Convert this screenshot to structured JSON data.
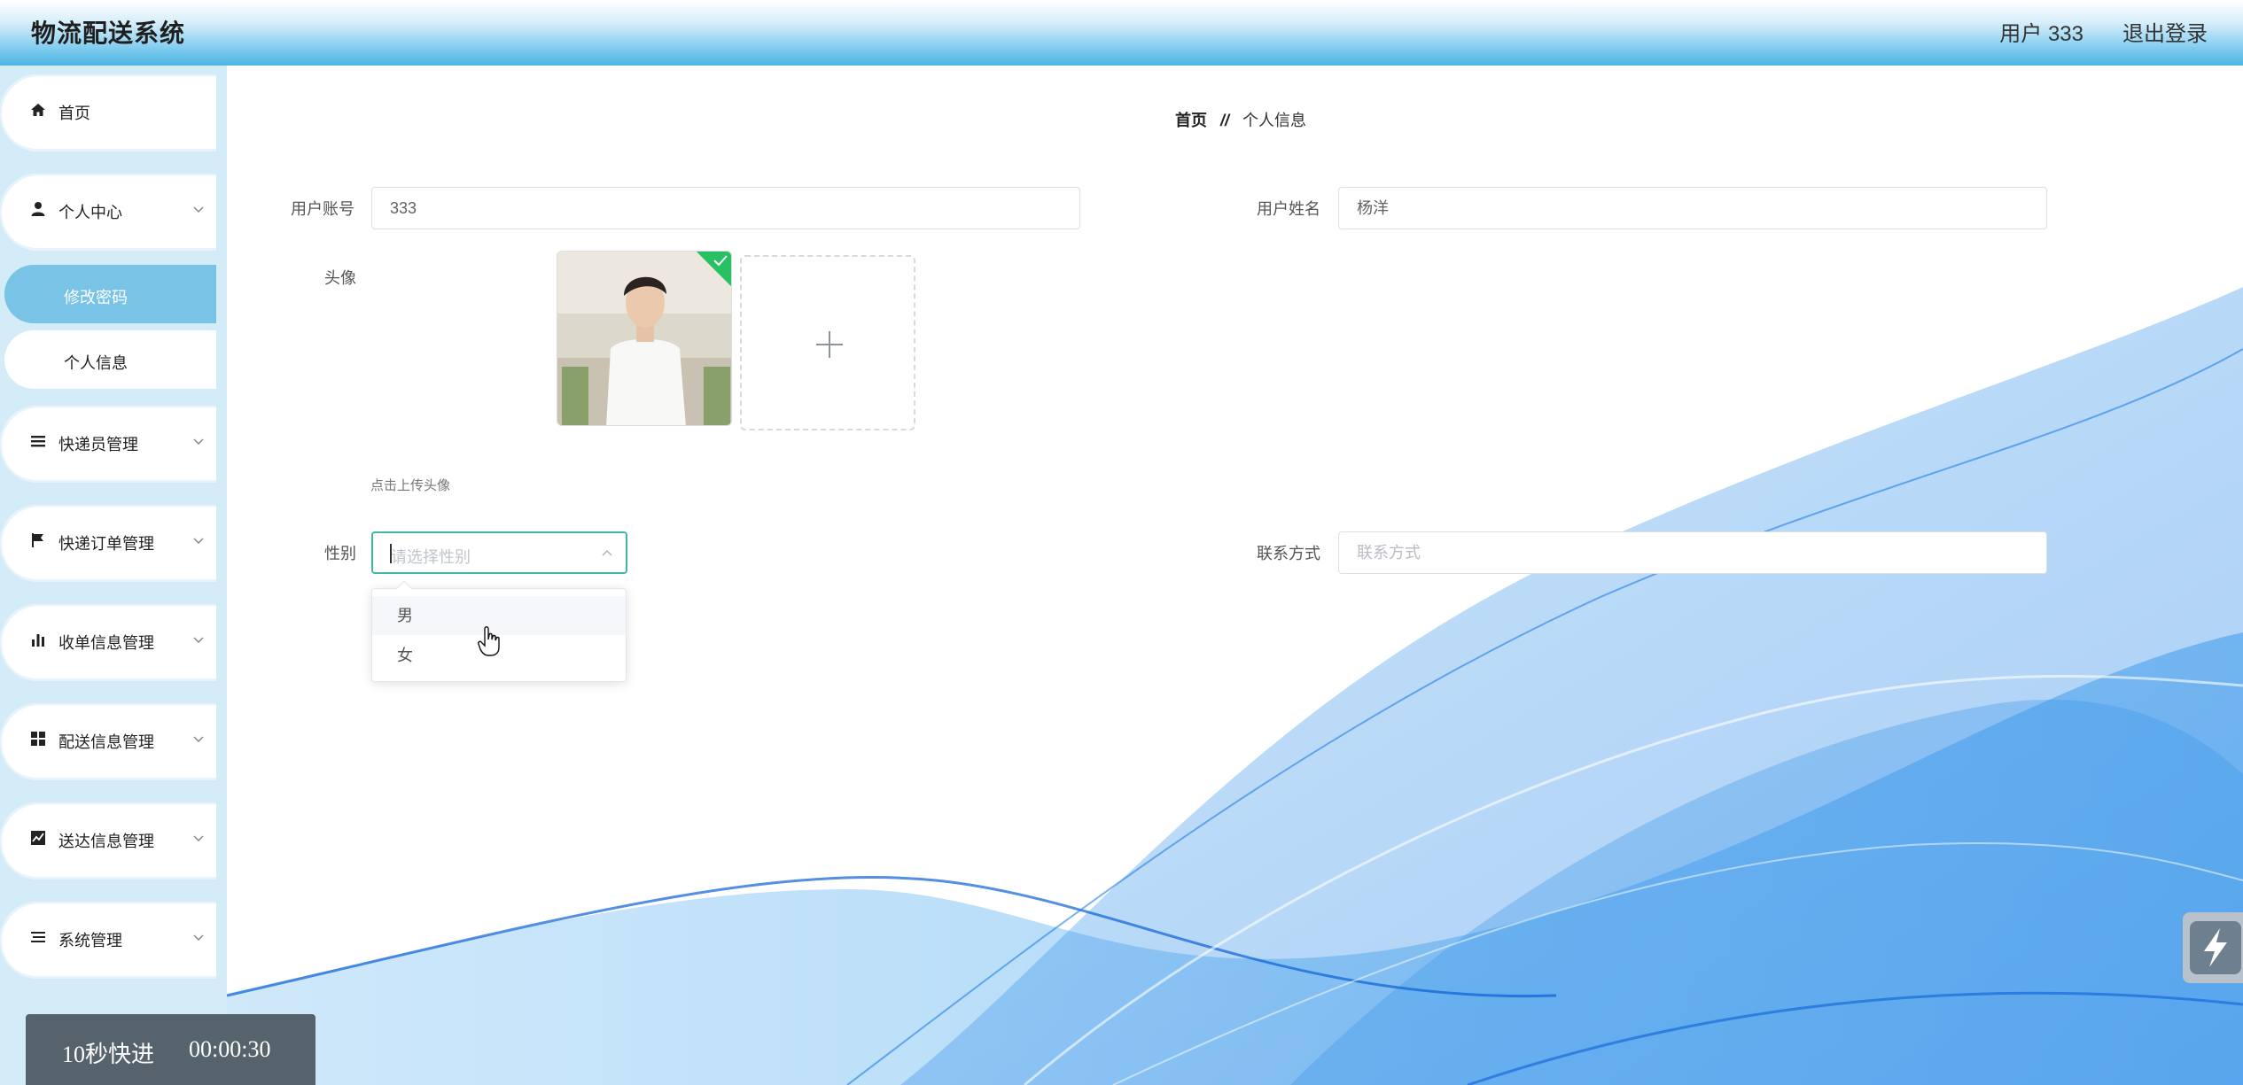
{
  "header": {
    "app_title": "物流配送系统",
    "user_label": "用户 333",
    "logout_label": "退出登录"
  },
  "sidebar": {
    "items": [
      {
        "label": "首页",
        "icon": "home-icon"
      },
      {
        "label": "个人中心",
        "icon": "user-icon"
      },
      {
        "label": "快递员管理",
        "icon": "list-icon"
      },
      {
        "label": "快递订单管理",
        "icon": "flag-icon"
      },
      {
        "label": "收单信息管理",
        "icon": "bar-chart-icon"
      },
      {
        "label": "配送信息管理",
        "icon": "grid-icon"
      },
      {
        "label": "送达信息管理",
        "icon": "line-chart-icon"
      },
      {
        "label": "系统管理",
        "icon": "menu-icon"
      }
    ],
    "submenu": [
      {
        "label": "修改密码",
        "active": true
      },
      {
        "label": "个人信息",
        "active": false
      }
    ]
  },
  "breadcrumb": {
    "home": "首页",
    "separator": "//",
    "current": "个人信息"
  },
  "form": {
    "account_label": "用户账号",
    "account_value": "333",
    "name_label": "用户姓名",
    "name_value": "杨洋",
    "avatar_label": "头像",
    "upload_tip": "点击上传头像",
    "gender_label": "性别",
    "gender_placeholder": "请选择性别",
    "gender_options": [
      "男",
      "女"
    ],
    "contact_label": "联系方式",
    "contact_placeholder": "联系方式"
  },
  "timer": {
    "label": "10秒快进",
    "time": "00:00:30"
  },
  "colors": {
    "accent": "#78c3e6",
    "sidebar_bg": "#d3ecf8",
    "select_border": "#3fb6a6",
    "upload_success": "#27c164"
  }
}
